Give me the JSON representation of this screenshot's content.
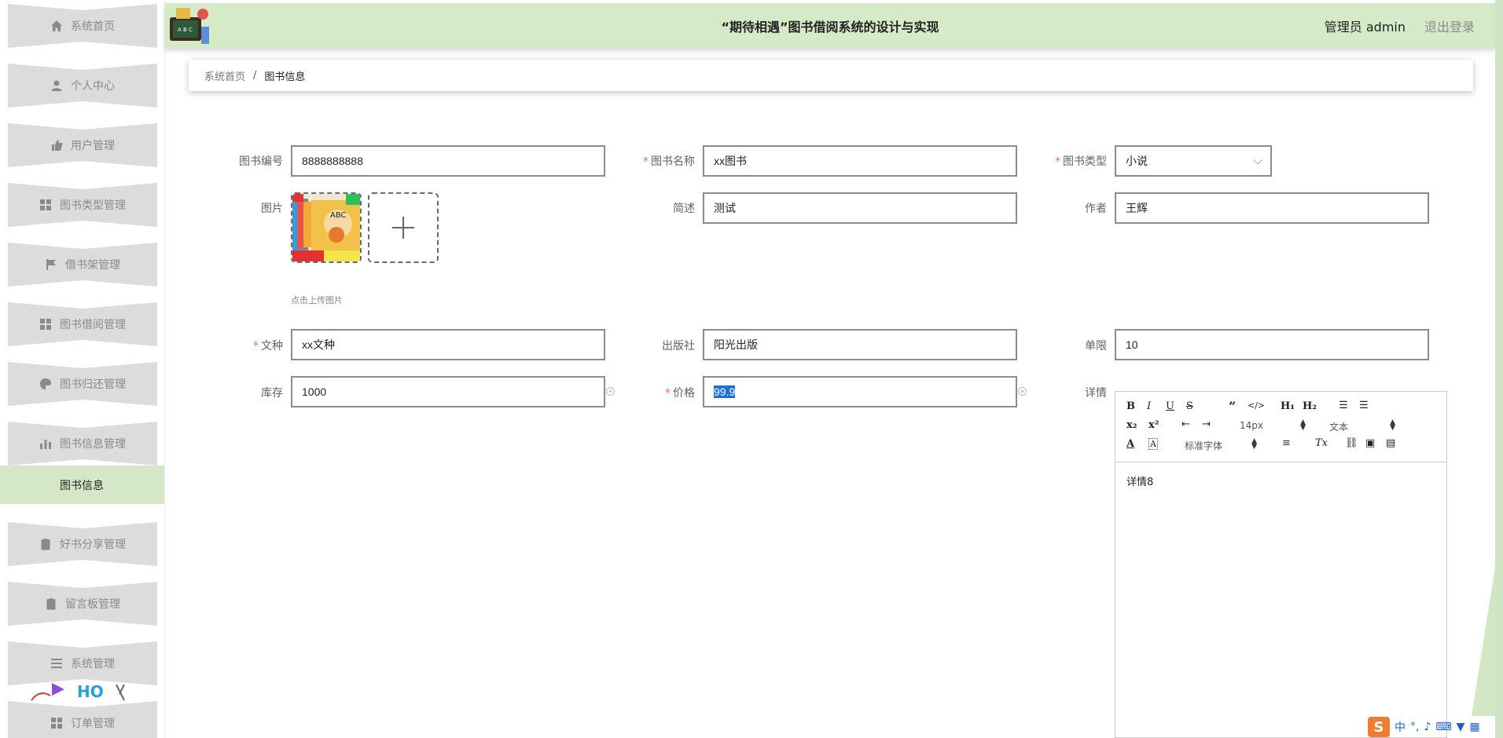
{
  "sidebar": {
    "items": [
      {
        "label": "系统首页",
        "icon": "home-icon"
      },
      {
        "label": "个人中心",
        "icon": "user-icon"
      },
      {
        "label": "用户管理",
        "icon": "thumb-icon"
      },
      {
        "label": "图书类型管理",
        "icon": "grid-icon"
      },
      {
        "label": "借书架管理",
        "icon": "flag-icon"
      },
      {
        "label": "图书借阅管理",
        "icon": "grid-icon"
      },
      {
        "label": "图书归还管理",
        "icon": "palette-icon"
      },
      {
        "label": "图书信息管理",
        "icon": "chart-icon"
      },
      {
        "label": "好书分享管理",
        "icon": "clipboard-check-icon"
      },
      {
        "label": "留言板管理",
        "icon": "clipboard-icon"
      },
      {
        "label": "系统管理",
        "icon": "menu-icon"
      },
      {
        "label": "订单管理",
        "icon": "grid-icon"
      }
    ],
    "active_submenu": "图书信息"
  },
  "header": {
    "title": "“期待相遇”图书借阅系统的设计与实现",
    "user": "管理员 admin",
    "logout": "退出登录"
  },
  "breadcrumb": {
    "home": "系统首页",
    "separator": "/",
    "current": "图书信息"
  },
  "form": {
    "book_no": {
      "label": "图书编号",
      "value": "8888888888"
    },
    "book_name": {
      "label": "图书名称",
      "value": "xx图书",
      "required": true
    },
    "book_type": {
      "label": "图书类型",
      "value": "小说",
      "required": true
    },
    "image": {
      "label": "图片",
      "tip": "点击上传图片"
    },
    "summary": {
      "label": "简述",
      "value": "测试"
    },
    "author": {
      "label": "作者",
      "value": "王辉"
    },
    "language": {
      "label": "文种",
      "value": "xx文种",
      "required": true
    },
    "publisher": {
      "label": "出版社",
      "value": "阳光出版"
    },
    "limit": {
      "label": "单限",
      "value": "10"
    },
    "stock": {
      "label": "库存",
      "value": "1000"
    },
    "price": {
      "label": "价格",
      "value": "99.9",
      "required": true
    },
    "detail": {
      "label": "详情",
      "value": "详情8"
    }
  },
  "editor": {
    "font_size": "14px",
    "block_format": "文本",
    "font_family": "标准字体"
  },
  "ime": {
    "lang": "中"
  }
}
